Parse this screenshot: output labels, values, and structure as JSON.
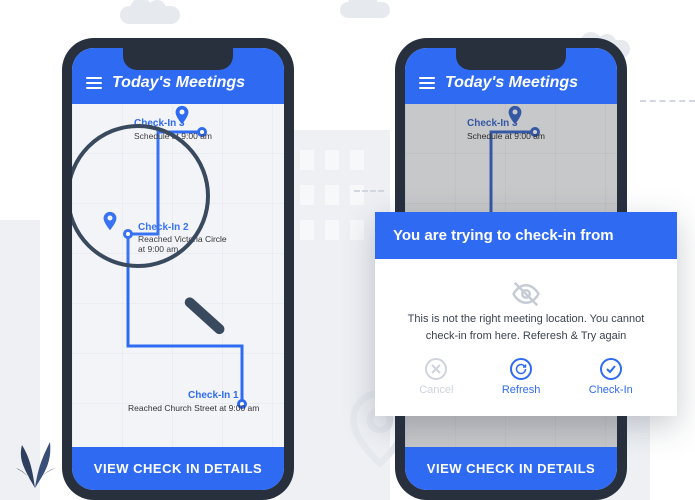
{
  "header": {
    "title": "Today's Meetings"
  },
  "checkins": {
    "c3": {
      "label": "Check-In 3",
      "sub": "Schedule at 9:00 am"
    },
    "c2": {
      "label": "Check-In 2",
      "sub": "Reached Victoria Circle at 9:00 am"
    },
    "c1": {
      "label": "Check-In 1",
      "sub": "Reached Church Street at 9:00 am"
    }
  },
  "bottom": {
    "viewDetails": "VIEW CHECK IN DETAILS"
  },
  "modal": {
    "title": "You are trying to check-in from",
    "message": "This is not the right meeting location. You cannot check-in from here. Referesh & Try again",
    "actions": {
      "cancel": "Cancel",
      "refresh": "Refresh",
      "checkin": "Check-In"
    }
  }
}
